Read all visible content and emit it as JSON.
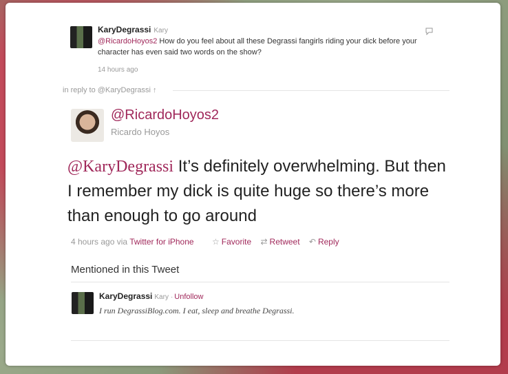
{
  "parent_tweet": {
    "username": "KaryDegrassi",
    "fullname": "Kary",
    "mention": "@RicardoHoyos2",
    "text": " How do you feel about all these Degrassi fangirls riding your dick before your character has even said two words on the show?",
    "time": "14 hours ago"
  },
  "in_reply_to": "in reply to @KaryDegrassi ↑",
  "main_tweet": {
    "handle": "@RicardoHoyos2",
    "fullname": "Ricardo Hoyos",
    "mention": "@KaryDegrassi",
    "text": " It’s definitely overwhelming. But then I remember my dick is quite huge so there’s more than enough to go around",
    "time": "4 hours ago",
    "via": "via",
    "source": "Twitter for iPhone",
    "actions": {
      "favorite": "Favorite",
      "retweet": "Retweet",
      "reply": "Reply"
    }
  },
  "mentioned_section": {
    "heading": "Mentioned in this Tweet",
    "user": {
      "username": "KaryDegrassi",
      "fullname": "Kary",
      "separator": "·",
      "unfollow": "Unfollow",
      "bio": "I run DegrassiBlog.com. I eat, sleep and breathe Degrassi."
    }
  },
  "colors": {
    "accent": "#a0285a",
    "muted": "#999999"
  },
  "icons": [
    "reply-icon",
    "star-icon",
    "retweet-icon",
    "reply-arrow-icon"
  ]
}
